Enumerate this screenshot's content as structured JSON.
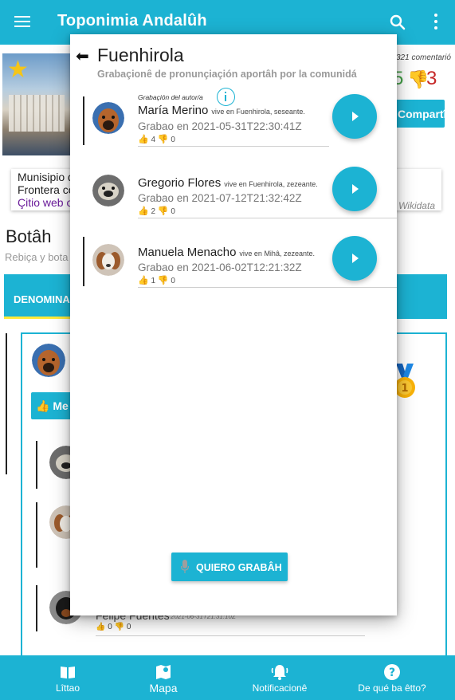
{
  "appbar": {
    "title": "Toponimia Andalûh"
  },
  "background": {
    "comments_count": "321 comentarió",
    "votes_up": "5",
    "votes_down": "3",
    "share_label": "Compartîh",
    "card_line1": "Munisipio d",
    "card_line2": "Frontera co",
    "card_line3": "Çitio web o",
    "card_source": "r Wikidata",
    "heading": "Botâh",
    "subheading": "Rebiça y bota",
    "tab_label": "DENOMINA",
    "like_label": "Me",
    "felipe_name": "Felipe Fuentes",
    "felipe_date": "2021-06-31T21:31:10Z",
    "felipe_votes_up": "0",
    "felipe_votes_down": "0"
  },
  "modal": {
    "title": "Fuenhirola",
    "subtitle": "Grabaçionê de pronunçiaçión aportâh por la comunidá",
    "recordings": [
      {
        "author_label": "Grabaçión del autor/a",
        "name": "María Merino",
        "location": "vive en Fuenhirola, seseante.",
        "date": "Grabao en 2021-05-31T22:30:41Z",
        "votes_up": "4",
        "votes_down": "0"
      },
      {
        "name": "Gregorio Flores",
        "location": "vive en Fuenhirola, zezeante.",
        "date": "Grabao en 2021-07-12T21:32:42Z",
        "votes_up": "2",
        "votes_down": "0"
      },
      {
        "name": "Manuela Menacho",
        "location": "vive en Mihâ, zezeante.",
        "date": "Grabao en 2021-06-02T12:21:32Z",
        "votes_up": "1",
        "votes_down": "0"
      }
    ],
    "record_button": "QUIERO GRABÂH"
  },
  "bottom_nav": [
    {
      "label": "Lîttao",
      "icon": "book-icon"
    },
    {
      "label": "Mapa",
      "icon": "map-icon"
    },
    {
      "label": "Notificacionê",
      "icon": "bell-icon"
    },
    {
      "label": "De qué ba êtto?",
      "icon": "help-icon"
    }
  ],
  "colors": {
    "accent": "#1cb3d3",
    "up": "#43a047",
    "down": "#c62828"
  }
}
